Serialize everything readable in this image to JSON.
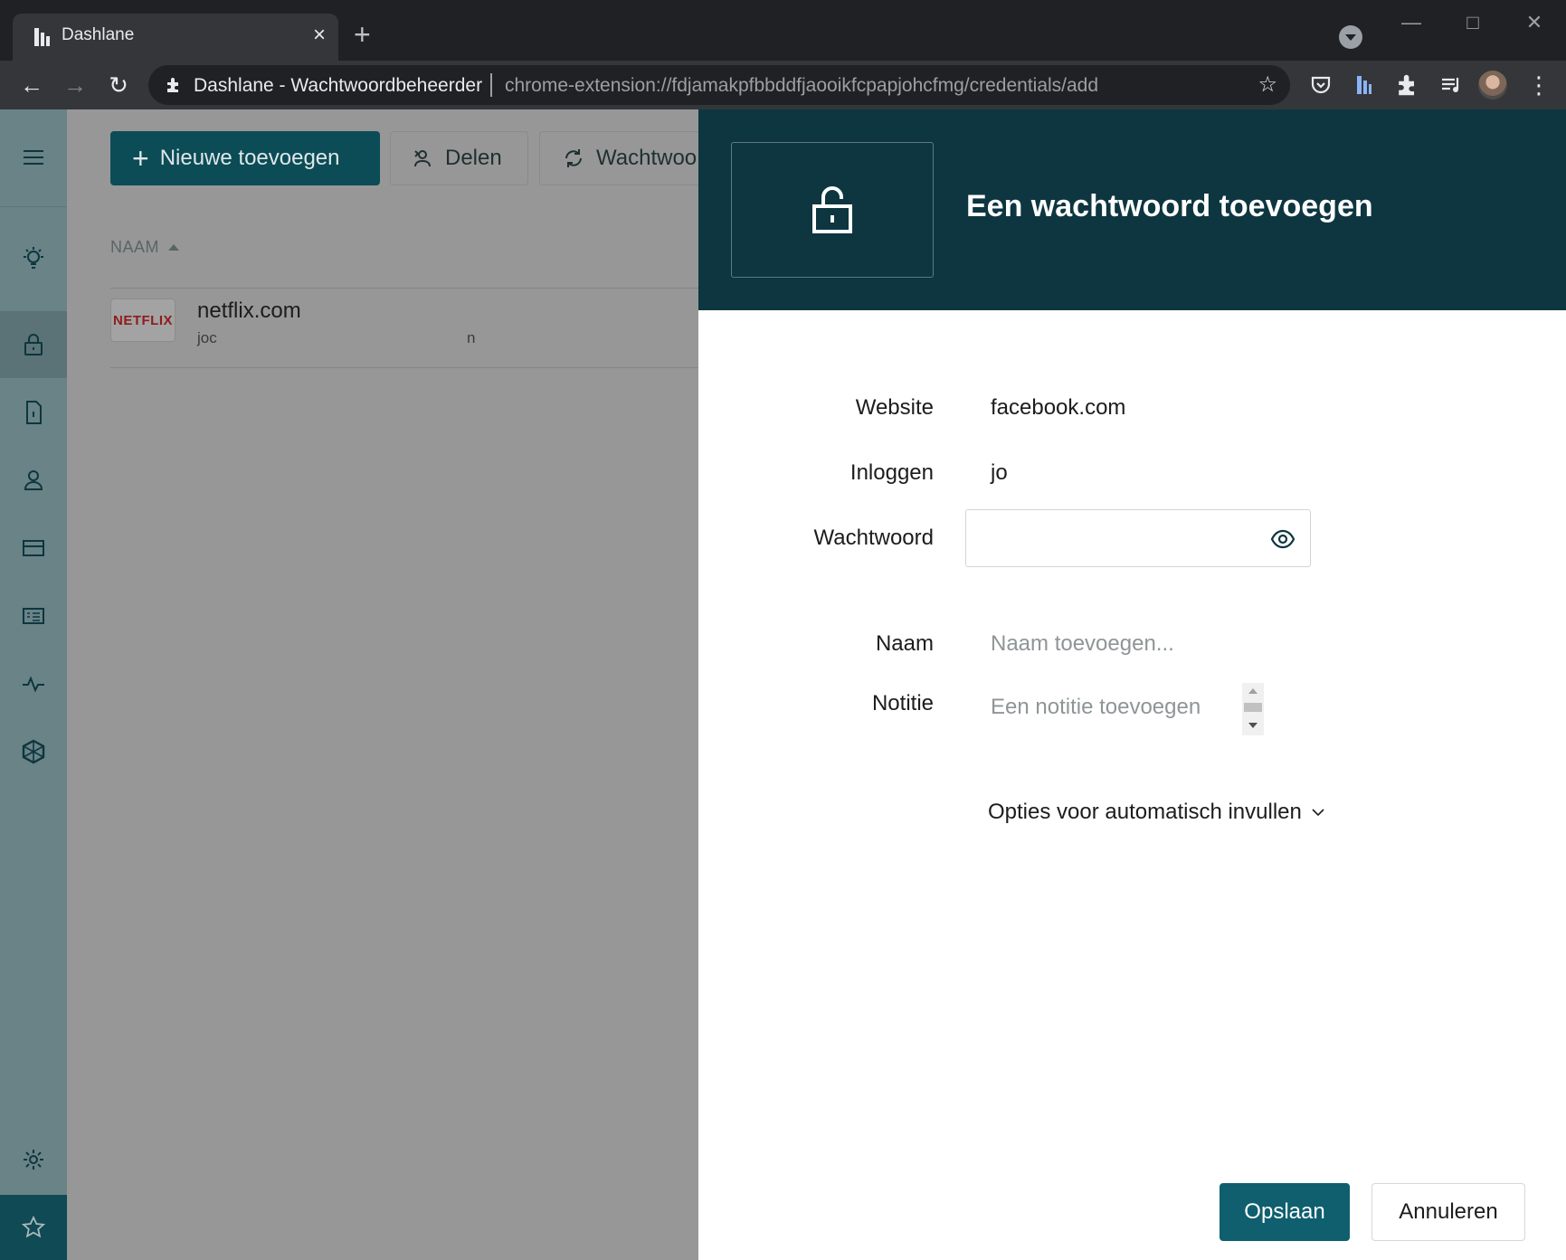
{
  "browser": {
    "tab_title": "Dashlane",
    "site_name": "Dashlane - Wachtwoordbeheerder",
    "url": "chrome-extension://fdjamakpfbbddfjaooikfcpapjohcfmg/credentials/add"
  },
  "toolbar": {
    "add_new_label": "Nieuwe toevoegen",
    "share_label": "Delen",
    "password_label": "Wachtwoo"
  },
  "list": {
    "column_header": "NAAM",
    "rows": [
      {
        "logo_text": "NETFLIX",
        "title": "netflix.com",
        "login_start": "joc",
        "login_end": "n"
      }
    ]
  },
  "panel": {
    "title": "Een wachtwoord toevoegen",
    "fields": {
      "website_label": "Website",
      "website_value": "facebook.com",
      "login_label": "Inloggen",
      "login_value": "jo",
      "password_label": "Wachtwoord",
      "name_label": "Naam",
      "name_placeholder": "Naam toevoegen...",
      "note_label": "Notitie",
      "note_placeholder": "Een notitie toevoegen"
    },
    "autofill_label": "Opties voor automatisch invullen",
    "save_label": "Opslaan",
    "cancel_label": "Annuleren"
  },
  "colors": {
    "brand_dark": "#0d3640",
    "primary_button": "#0f5f6f",
    "sidebar": "#6a8386",
    "overlay": "#979797"
  },
  "icons": {
    "sidebar": [
      "menu-icon",
      "lightbulb-icon",
      "lock-icon",
      "document-icon",
      "person-icon",
      "card-icon",
      "id-card-icon",
      "pulse-icon",
      "cube-icon",
      "settings-icon",
      "star-icon"
    ],
    "panel": "unlocked-padlock-icon"
  }
}
